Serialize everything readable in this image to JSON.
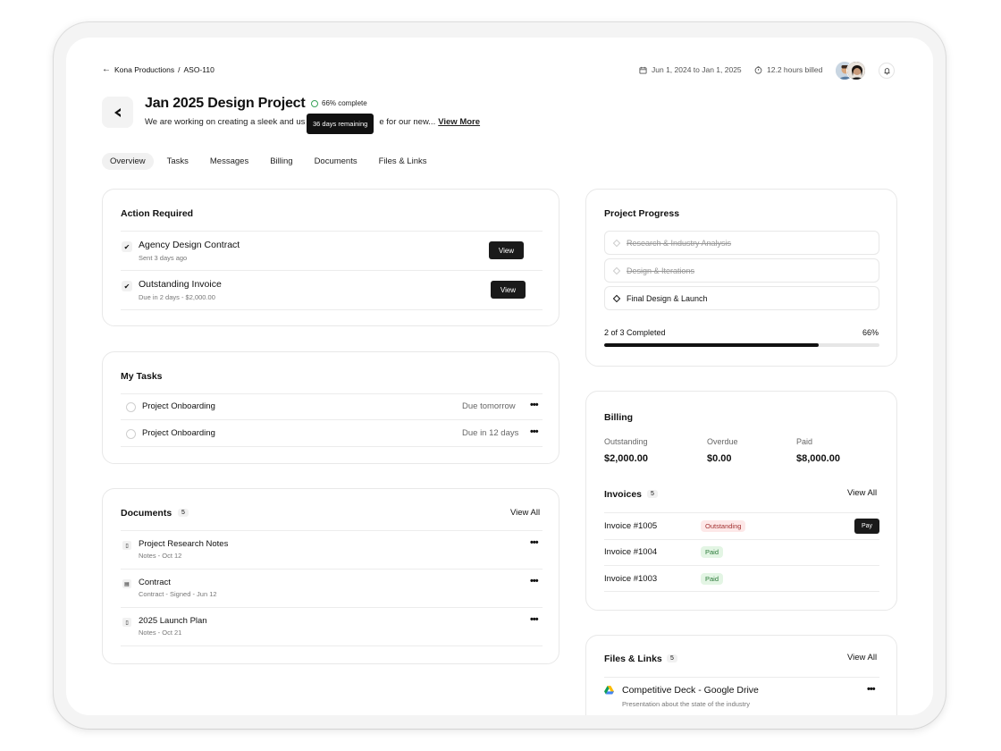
{
  "breadcrumb": {
    "back": "←",
    "org": "Kona Productions",
    "sep": "/",
    "code": "ASO-110"
  },
  "header_meta": {
    "dates": "Jun 1, 2024 to Jan 1, 2025",
    "hours": "12.2 hours billed"
  },
  "project": {
    "title": "Jan 2025 Design Project",
    "progress_label": "66% complete",
    "description": "We are working on creating a sleek and us",
    "description_tail": "e for our new...",
    "view_more": "View More",
    "tooltip": "36 days remaining"
  },
  "tabs": [
    {
      "label": "Overview",
      "active": true
    },
    {
      "label": "Tasks",
      "active": false
    },
    {
      "label": "Messages",
      "active": false
    },
    {
      "label": "Billing",
      "active": false
    },
    {
      "label": "Documents",
      "active": false
    },
    {
      "label": "Files & Links",
      "active": false
    }
  ],
  "action_required": {
    "title": "Action Required",
    "items": [
      {
        "title": "Agency Design Contract",
        "sub": "Sent 3 days ago",
        "button": "View",
        "check": "✔"
      },
      {
        "title": "Outstanding Invoice",
        "sub": "Due in 2 days - $2,000.00",
        "button": "View",
        "check": "✔"
      }
    ]
  },
  "my_tasks": {
    "title": "My Tasks",
    "items": [
      {
        "title": "Project Onboarding",
        "due": "Due tomorrow",
        "menu": "•••"
      },
      {
        "title": "Project Onboarding",
        "due": "Due in 12 days",
        "menu": "•••"
      }
    ]
  },
  "documents": {
    "title": "Documents",
    "count": "5",
    "view_all": "View All",
    "items": [
      {
        "title": "Project Research Notes",
        "sub": "Notes - Oct 12",
        "menu": "•••"
      },
      {
        "title": "Contract",
        "sub": "Contract - Signed - Jun 12",
        "menu": "•••"
      },
      {
        "title": "2025 Launch Plan",
        "sub": "Notes - Oct 21",
        "menu": "•••"
      }
    ]
  },
  "project_progress": {
    "title": "Project Progress",
    "steps": [
      {
        "label": "Research & Industry Analysis",
        "state": "done"
      },
      {
        "label": "Design & Iterations",
        "state": "done"
      },
      {
        "label": "Final Design & Launch",
        "state": "current"
      }
    ],
    "completed_label": "2 of 3 Completed",
    "percent_label": "66%",
    "percent_value": 0.78
  },
  "billing": {
    "title": "Billing",
    "outstanding_label": "Outstanding",
    "outstanding_value": "$2,000.00",
    "overdue_label": "Overdue",
    "overdue_value": "$0.00",
    "paid_label": "Paid",
    "paid_value": "$8,000.00",
    "invoices_title": "Invoices",
    "invoices_count": "5",
    "view_all": "View All",
    "invoices": [
      {
        "id": "Invoice #1005",
        "status": "Outstanding",
        "action": "Pay"
      },
      {
        "id": "Invoice #1004",
        "status": "Paid"
      },
      {
        "id": "Invoice #1003",
        "status": "Paid"
      }
    ]
  },
  "files_links": {
    "title": "Files & Links",
    "count": "5",
    "view_all": "View All",
    "items": [
      {
        "title": "Competitive Deck - Google Drive",
        "sub": "Presentation about the state of the industry",
        "menu": "•••"
      }
    ]
  },
  "colors": {
    "accent_dark": "#111111",
    "progress_green": "#3aa35a",
    "tag_red_bg": "#fde8e8",
    "tag_green_bg": "#e3f5e4"
  }
}
